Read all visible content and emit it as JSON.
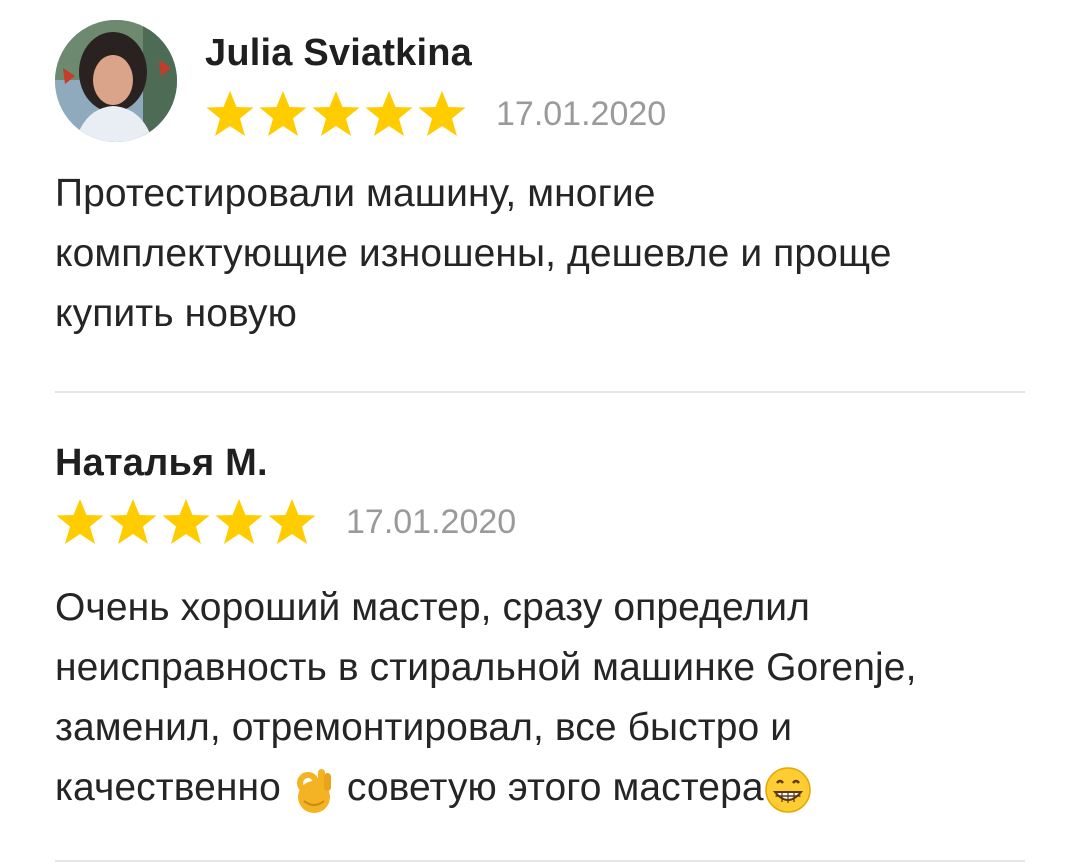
{
  "reviews": [
    {
      "author": "Julia Sviatkina",
      "rating": 5,
      "max_rating": 5,
      "date": "17.01.2020",
      "text": "Протестировали машину, многие\nкомплектующие изношены, дешевле и проще\nкупить новую"
    },
    {
      "author": "Наталья М.",
      "rating": 5,
      "max_rating": 5,
      "date": "17.01.2020",
      "text_part1": "Очень хороший мастер, сразу определил\nнеисправность в стиральной машинке Gorenje,\nзаменил, отремонтировал, все быстро и\nкачественно ",
      "emoji_1": "ok-hand-emoji",
      "text_part2": " советую этого мастера",
      "emoji_2": "grinning-face-emoji"
    }
  ],
  "colors": {
    "star": "#ffcc00",
    "date": "#9a9a9a",
    "divider": "#e5e5e5",
    "text": "#252525"
  }
}
